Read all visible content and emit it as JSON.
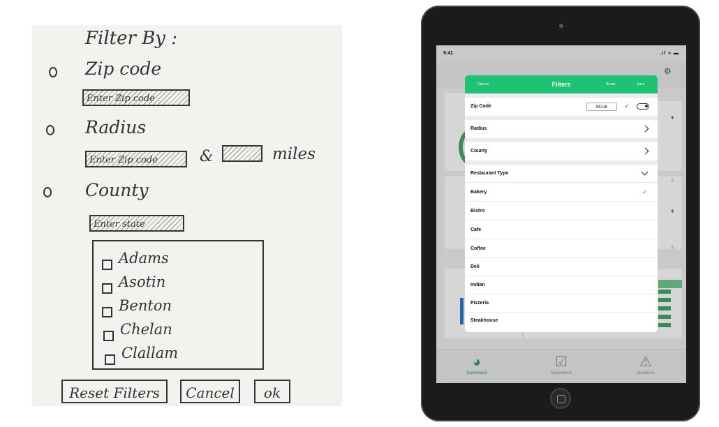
{
  "sketch": {
    "title": "Filter By :",
    "zip_label": "Zip code",
    "zip_field": "Enter Zip code",
    "radius_label": "Radius",
    "radius_field": "Enter Zip code",
    "amp": "&",
    "miles_label": "miles",
    "county_label": "County",
    "state_field": "Enter state",
    "counties": [
      "Adams",
      "Asotin",
      "Benton",
      "Chelan",
      "Clallam"
    ],
    "reset_button": "Reset Filters",
    "cancel_button": "Cancel",
    "ok_button": "ok"
  },
  "tablet": {
    "status_time": "9:41",
    "status_icons": ".ıl ≈ ▬",
    "modal": {
      "cancel": "Cancel",
      "title": "Filters",
      "reset": "Reset",
      "save": "Save",
      "zip_label": "Zip Code",
      "zip_value": "98116",
      "radius_label": "Radius",
      "county_label": "County",
      "restaurant_type_label": "Restaurant Type",
      "types": [
        "Bakery",
        "Bistro",
        "Cafe",
        "Coffee",
        "Deli",
        "Indian",
        "Pizzeria",
        "Steakhouse"
      ],
      "selected_type": "Bakery"
    },
    "tabs": [
      {
        "label": "Dashboard",
        "icon": "pie-chart-icon",
        "active": true
      },
      {
        "label": "Inspections",
        "icon": "clipboard-check-icon",
        "active": false
      },
      {
        "label": "Violations",
        "icon": "warning-triangle-icon",
        "active": false
      }
    ],
    "accent_color": "#1fc274",
    "check_color": "#2a7fd4"
  }
}
